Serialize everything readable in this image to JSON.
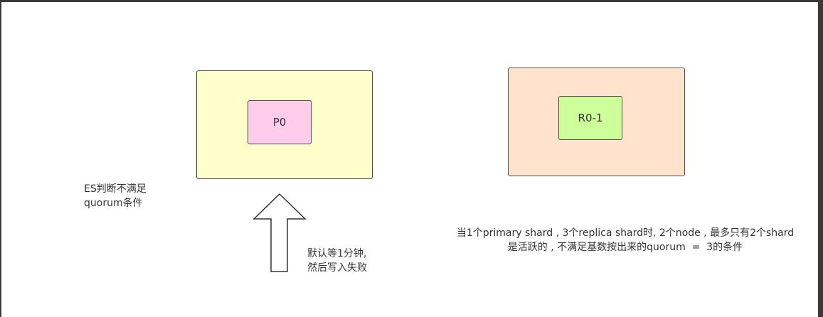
{
  "diagram": {
    "node_1": {
      "shard_label": "P0"
    },
    "node_2": {
      "shard_label": "R0-1"
    },
    "es_note": "ES判断不满足\nquorum条件",
    "wait_note": "默认等1分钟,\n然后写入失败",
    "condition_note": "当1个primary shard , 3个replica shard时, 2个node , 最多只有2个shard\n是活跃的 , 不满足基数按出来的quorum  =  3的条件"
  },
  "colors": {
    "node_1_fill": "#ffffcc",
    "node_2_fill": "#ffe3cc",
    "primary_shard_fill": "#ffccec",
    "replica_shard_fill": "#ccff99",
    "border": "#4a4a4a",
    "frame": "#3a3a3a"
  }
}
